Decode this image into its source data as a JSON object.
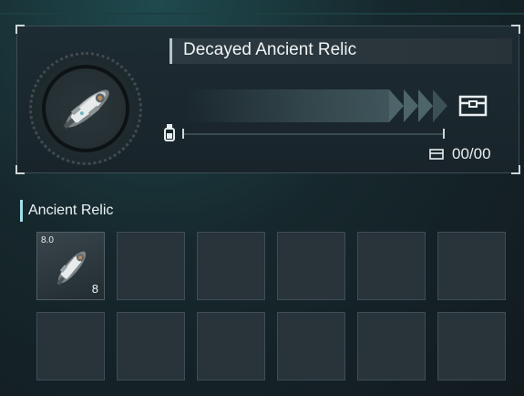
{
  "item": {
    "name": "Decayed Ancient Relic",
    "icon": "ancient-relic-icon",
    "count_display": "00/00"
  },
  "inventory": {
    "section_title": "Ancient Relic",
    "slots": [
      {
        "tag": "8.0",
        "quantity": "8",
        "icon": "ancient-relic-icon"
      },
      {},
      {},
      {},
      {},
      {},
      {},
      {},
      {},
      {},
      {},
      {}
    ]
  },
  "colors": {
    "accent": "#9fe0e6",
    "panel": "#1d2b32",
    "slot": "#28343a"
  }
}
